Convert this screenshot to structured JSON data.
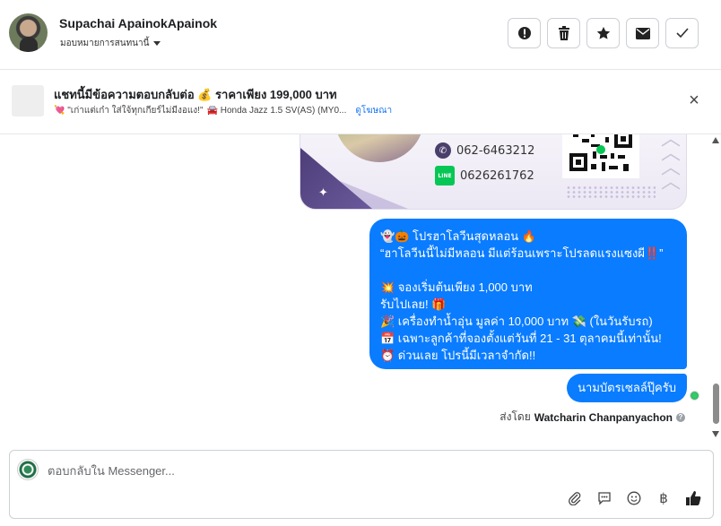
{
  "header": {
    "user_name": "Supachai ApainokApainok",
    "assign_label": "มอบหมายการสนทนานี้",
    "actions": [
      {
        "icon": "alert-icon",
        "glyph": "!"
      },
      {
        "icon": "trash-icon",
        "glyph": "🗑"
      },
      {
        "icon": "star-icon",
        "glyph": "★"
      },
      {
        "icon": "envelope-icon",
        "glyph": "✉"
      },
      {
        "icon": "check-icon",
        "glyph": "✓"
      }
    ]
  },
  "ad": {
    "title": "แชทนี้มีข้อความตอบกลับต่อ 💰 ราคาเพียง 199,000 บาท",
    "subtitle_quote": "💘 \"เก่าแต่เก๋า ใส่ใจ้ทุกเกียร์ไม่มีงอแง!\"",
    "subtitle_car": "🚘 Honda Jazz 1.5 SV(AS) (MY0...",
    "link": "ดูโฆษณา"
  },
  "card": {
    "phone": "062-6463212",
    "line_id": "0626261762",
    "line_label": "LINE"
  },
  "messages": {
    "m1_line1": "👻🎃 โปรฮาโลวีนสุดหลอน 🔥",
    "m1_line2": "“ฮาโลวีนนี้ไม่มีหลอน มีแต่ร้อนเพราะโปรลดแรงแซงผี‼️”",
    "m1_line3": "💥 จองเริ่มต้นเพียง 1,000 บาท",
    "m1_line4": "รับไปเลย! 🎁",
    "m1_line5": "🎉 เครื่องทำน้ำอุ่น มูลค่า 10,000 บาท 💸 (ในวันรับรถ)",
    "m1_line6": "📅 เฉพาะลูกค้าที่จองตั้งแต่วันที่ 21 - 31 ตุลาคมนี้เท่านั้น!",
    "m1_line7": "⏰ ด่วนเลย โปรนี้มีเวลาจำกัด!!",
    "m2": "นามบัตรเซลล์ปุ๊ครับ",
    "sent_by_prefix": "ส่งโดย",
    "sent_by_name": "Watcharin Chanpanyachon"
  },
  "composer": {
    "placeholder": "ตอบกลับใน Messenger...",
    "value": "",
    "tools": [
      {
        "icon": "paperclip-icon",
        "glyph": "📎"
      },
      {
        "icon": "saved-reply-icon",
        "glyph": "💬"
      },
      {
        "icon": "emoji-icon",
        "glyph": "☺"
      },
      {
        "icon": "baht-icon",
        "glyph": "฿"
      },
      {
        "icon": "thumbs-up-icon",
        "glyph": "👍"
      }
    ]
  }
}
